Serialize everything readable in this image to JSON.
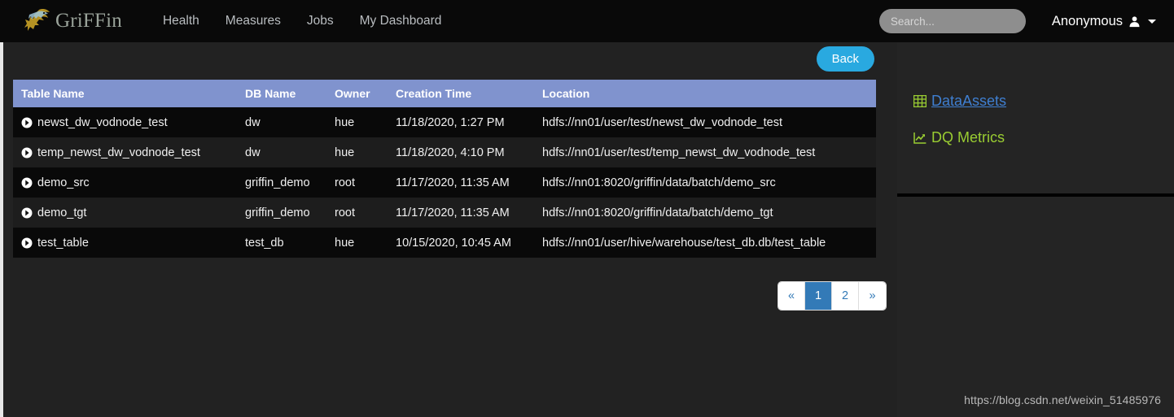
{
  "navbar": {
    "brand": "GriFFin",
    "logo_icon": "griffin-logo-icon",
    "links": [
      {
        "label": "Health"
      },
      {
        "label": "Measures"
      },
      {
        "label": "Jobs"
      },
      {
        "label": "My Dashboard"
      }
    ],
    "search": {
      "value": "",
      "placeholder": "Search..."
    },
    "user": {
      "name": "Anonymous",
      "icon": "user-icon",
      "caret": "caret-down-icon"
    }
  },
  "toolbar": {
    "back_label": "Back"
  },
  "table": {
    "columns": [
      "Table Name",
      "DB Name",
      "Owner",
      "Creation Time",
      "Location"
    ],
    "row_icon": "chevron-circle-right-icon",
    "rows": [
      {
        "name": "newst_dw_vodnode_test",
        "db": "dw",
        "owner": "hue",
        "created": "11/18/2020, 1:27 PM",
        "location": "hdfs://nn01/user/test/newst_dw_vodnode_test"
      },
      {
        "name": "temp_newst_dw_vodnode_test",
        "db": "dw",
        "owner": "hue",
        "created": "11/18/2020, 4:10 PM",
        "location": "hdfs://nn01/user/test/temp_newst_dw_vodnode_test"
      },
      {
        "name": "demo_src",
        "db": "griffin_demo",
        "owner": "root",
        "created": "11/17/2020, 11:35 AM",
        "location": "hdfs://nn01:8020/griffin/data/batch/demo_src"
      },
      {
        "name": "demo_tgt",
        "db": "griffin_demo",
        "owner": "root",
        "created": "11/17/2020, 11:35 AM",
        "location": "hdfs://nn01:8020/griffin/data/batch/demo_tgt"
      },
      {
        "name": "test_table",
        "db": "test_db",
        "owner": "hue",
        "created": "10/15/2020, 10:45 AM",
        "location": "hdfs://nn01/user/hive/warehouse/test_db.db/test_table"
      }
    ]
  },
  "pagination": {
    "prev": "«",
    "next": "»",
    "pages": [
      "1",
      "2"
    ],
    "active": "1"
  },
  "sidebar": {
    "links": [
      {
        "label": "DataAssets",
        "icon": "table-grid-icon",
        "color": "#3f7fd1"
      },
      {
        "label": "DQ Metrics",
        "icon": "chart-line-icon",
        "color": "#9acd32"
      }
    ]
  },
  "watermark": {
    "text": "https://blog.csdn.net/weixin_51485976"
  },
  "colors": {
    "navbar_bg": "#090909",
    "page_bg": "#222222",
    "table_header": "#8093ce",
    "row_odd": "#090909",
    "row_even": "#1d1d1d",
    "back_button": "#29a9e0",
    "pager_active": "#337ab7",
    "link_blue": "#3f7fd1",
    "link_green": "#9acd32"
  }
}
